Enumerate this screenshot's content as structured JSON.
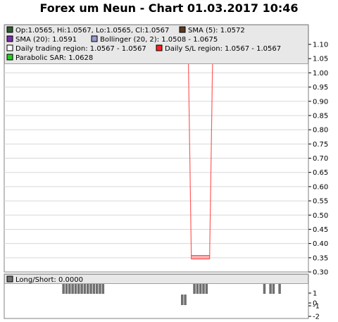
{
  "title": "Forex um Neun - Chart 01.03.2017 10:46",
  "colors": {
    "background": "#ffffff",
    "panel_bg": "#e8e8e8",
    "grid": "#d8d8d8",
    "bollinger": "#9999cc",
    "sma20": "#7a2ea8",
    "sma5": "#5c3a1e",
    "daily_sl": "#ff4040",
    "sar": "#22aa22",
    "longshort_bar": "#707070"
  },
  "chart_data": [
    {
      "type": "line",
      "title": "Forex um Neun - Chart 01.03.2017 10:46",
      "ylim": [
        0.3,
        1.12
      ],
      "yticks": [
        "1.10",
        "1.05",
        "1.00",
        "0.95",
        "0.90",
        "0.85",
        "0.80",
        "0.75",
        "0.70",
        "0.65",
        "0.60",
        "0.55",
        "0.50",
        "0.45",
        "0.40",
        "0.35",
        "0.30"
      ],
      "grid": true,
      "legend_position": "top-left",
      "legend": [
        {
          "label": "Op:1.0565, Hi:1.0567, Lo:1.0565, Cl:1.0567",
          "color": "#2e5e2e"
        },
        {
          "label": "SMA (5): 1.0572",
          "color": "#5c3a1e"
        },
        {
          "label": "SMA (20): 1.0591",
          "color": "#7a2ea8"
        },
        {
          "label": "Bollinger (20, 2): 1.0508 - 1.0675",
          "color": "#9999cc"
        },
        {
          "label": "Daily trading region: 1.0567 - 1.0567",
          "color": "#ffffff"
        },
        {
          "label": "Daily S/L region: 1.0567 - 1.0567",
          "color": "#ff2020"
        },
        {
          "label": "Parabolic SAR: 1.0628",
          "color": "#22cc22"
        }
      ],
      "series": [
        {
          "name": "Daily S/L region",
          "x": [
            0,
            60,
            61,
            62,
            63,
            64,
            65,
            66,
            67,
            68,
            99
          ],
          "values": [
            1.06,
            1.06,
            0.355,
            0.355,
            0.355,
            0.355,
            0.355,
            0.355,
            0.355,
            1.06,
            1.06
          ]
        },
        {
          "name": "SMA (20)",
          "x": [
            0,
            20,
            40,
            60,
            70,
            80,
            90,
            99
          ],
          "values": [
            1.062,
            1.063,
            1.062,
            1.061,
            1.06,
            1.059,
            1.058,
            1.058
          ]
        },
        {
          "name": "Bollinger (20, 2)",
          "x": [
            0,
            20,
            40,
            60,
            70,
            80,
            90,
            99
          ],
          "values": [
            1.066,
            1.067,
            1.067,
            1.067,
            1.066,
            1.065,
            1.064,
            1.063
          ]
        }
      ]
    },
    {
      "type": "bar",
      "title": "Long/Short: 0.0000",
      "ylim": [
        -2,
        1.5
      ],
      "yticks": [
        "1",
        "0",
        "-1",
        "-2"
      ],
      "x": [
        19,
        20,
        21,
        22,
        23,
        24,
        25,
        26,
        27,
        28,
        29,
        30,
        31,
        32,
        58,
        59,
        62,
        63,
        64,
        65,
        66,
        85,
        87,
        88,
        90
      ],
      "values": [
        1,
        1,
        1,
        1,
        1,
        1,
        1,
        1,
        1,
        1,
        1,
        1,
        1,
        1,
        -1,
        -1,
        1,
        1,
        1,
        1,
        1,
        1,
        1,
        1,
        1
      ]
    }
  ]
}
